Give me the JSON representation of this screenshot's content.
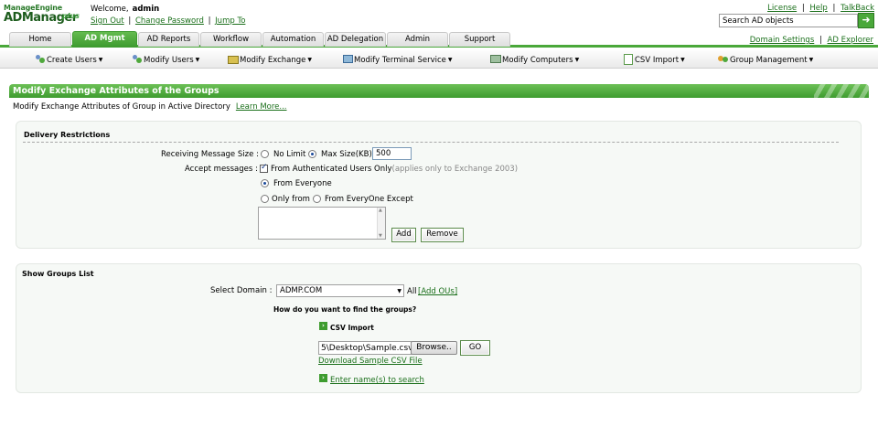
{
  "header": {
    "logo_brand": "ManageEngine",
    "logo_product": "ADManager",
    "logo_edition": "plus",
    "welcome_label": "Welcome,",
    "username": "admin",
    "sign_out": "Sign Out",
    "change_password": "Change Password",
    "jump_to": "Jump To",
    "separator": "|",
    "top_links": [
      "License",
      "Help",
      "TalkBack"
    ],
    "search_value": "Search AD objects",
    "search_icon": "arrow-right-icon",
    "domain_settings": "Domain Settings",
    "ad_explorer": "AD Explorer"
  },
  "tabs": [
    {
      "label": "Home",
      "active": false
    },
    {
      "label": "AD Mgmt",
      "active": true
    },
    {
      "label": "AD Reports",
      "active": false
    },
    {
      "label": "Workflow",
      "active": false
    },
    {
      "label": "Automation",
      "active": false
    },
    {
      "label": "AD Delegation",
      "active": false
    },
    {
      "label": "Admin",
      "active": false
    },
    {
      "label": "Support",
      "active": false
    }
  ],
  "submenu": [
    {
      "label": "Create Users",
      "icon": "users-icon"
    },
    {
      "label": "Modify Users",
      "icon": "users-icon"
    },
    {
      "label": "Modify Exchange",
      "icon": "exchange-icon"
    },
    {
      "label": "Modify Terminal Service",
      "icon": "terminal-icon"
    },
    {
      "label": "Modify Computers",
      "icon": "computer-icon"
    },
    {
      "label": "CSV Import",
      "icon": "csv-icon"
    },
    {
      "label": "Group Management",
      "icon": "group-icon"
    }
  ],
  "page": {
    "title": "Modify Exchange Attributes of the Groups",
    "description": "Modify Exchange Attributes of Group in Active Directory",
    "learn_more": "Learn More..."
  },
  "delivery": {
    "section_title": "Delivery Restrictions",
    "receiving_label": "Receiving Message Size :",
    "no_limit": "No Limit",
    "max_size": "Max Size(KB)",
    "max_size_value": "500",
    "accept_label": "Accept messages :",
    "from_authenticated": "From Authenticated Users Only",
    "authenticated_note": "(applies only to Exchange 2003)",
    "from_everyone": "From Everyone",
    "only_from": "Only from",
    "from_everyone_except": "From EveryOne Except",
    "add_button": "Add",
    "remove_button": "Remove"
  },
  "groups": {
    "section_title": "Show Groups List",
    "domain_label": "Select Domain :",
    "domain_value": "ADMP.COM",
    "all_label": "All",
    "add_ous": "[Add OUs]",
    "question": "How do you want to find the groups?",
    "csv_import": "CSV Import",
    "file_path": "5\\Desktop\\Sample.csv",
    "browse_button": "Browse..",
    "go_button": "GO",
    "download_sample": "Download Sample CSV File",
    "enter_names": "Enter name(s) to search"
  }
}
